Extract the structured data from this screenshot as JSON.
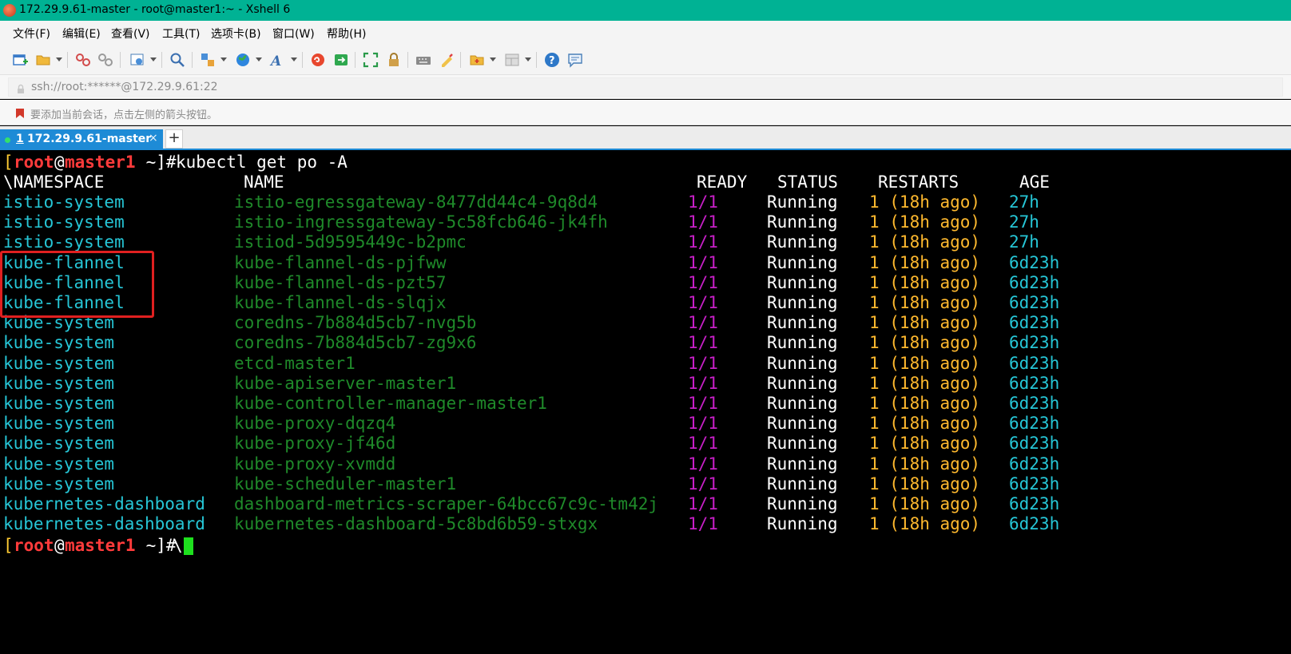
{
  "window": {
    "title": "172.29.9.61-master - root@master1:~ - Xshell 6"
  },
  "menu": [
    "文件(F)",
    "编辑(E)",
    "查看(V)",
    "工具(T)",
    "选项卡(B)",
    "窗口(W)",
    "帮助(H)"
  ],
  "address": {
    "value": "ssh://root:******@172.29.9.61:22"
  },
  "hint": {
    "text": "要添加当前会话，点击左侧的箭头按钮。"
  },
  "tabs": [
    {
      "number": "1",
      "label": "172.29.9.61-master",
      "close": "×"
    }
  ],
  "tab_add": "+",
  "terminal": {
    "prompt": {
      "open": "[",
      "user": "root",
      "at": "@",
      "host": "master1",
      "rest": " ~]#"
    },
    "command": "kubectl get po -A",
    "headers": {
      "namespace": "\\NAMESPACE",
      "name": "NAME",
      "ready": "READY",
      "status": "STATUS",
      "restarts": "RESTARTS",
      "age": "AGE"
    },
    "rows": [
      {
        "ns": "istio-system",
        "name": "istio-egressgateway-8477dd44c4-9q8d4",
        "ready": "1/1",
        "status": "Running",
        "restarts": "1 (18h ago)",
        "age": "27h"
      },
      {
        "ns": "istio-system",
        "name": "istio-ingressgateway-5c58fcb646-jk4fh",
        "ready": "1/1",
        "status": "Running",
        "restarts": "1 (18h ago)",
        "age": "27h"
      },
      {
        "ns": "istio-system",
        "name": "istiod-5d9595449c-b2pmc",
        "ready": "1/1",
        "status": "Running",
        "restarts": "1 (18h ago)",
        "age": "27h"
      },
      {
        "ns": "kube-flannel",
        "name": "kube-flannel-ds-pjfww",
        "ready": "1/1",
        "status": "Running",
        "restarts": "1 (18h ago)",
        "age": "6d23h"
      },
      {
        "ns": "kube-flannel",
        "name": "kube-flannel-ds-pzt57",
        "ready": "1/1",
        "status": "Running",
        "restarts": "1 (18h ago)",
        "age": "6d23h"
      },
      {
        "ns": "kube-flannel",
        "name": "kube-flannel-ds-slqjx",
        "ready": "1/1",
        "status": "Running",
        "restarts": "1 (18h ago)",
        "age": "6d23h"
      },
      {
        "ns": "kube-system",
        "name": "coredns-7b884d5cb7-nvg5b",
        "ready": "1/1",
        "status": "Running",
        "restarts": "1 (18h ago)",
        "age": "6d23h"
      },
      {
        "ns": "kube-system",
        "name": "coredns-7b884d5cb7-zg9x6",
        "ready": "1/1",
        "status": "Running",
        "restarts": "1 (18h ago)",
        "age": "6d23h"
      },
      {
        "ns": "kube-system",
        "name": "etcd-master1",
        "ready": "1/1",
        "status": "Running",
        "restarts": "1 (18h ago)",
        "age": "6d23h"
      },
      {
        "ns": "kube-system",
        "name": "kube-apiserver-master1",
        "ready": "1/1",
        "status": "Running",
        "restarts": "1 (18h ago)",
        "age": "6d23h"
      },
      {
        "ns": "kube-system",
        "name": "kube-controller-manager-master1",
        "ready": "1/1",
        "status": "Running",
        "restarts": "1 (18h ago)",
        "age": "6d23h"
      },
      {
        "ns": "kube-system",
        "name": "kube-proxy-dqzq4",
        "ready": "1/1",
        "status": "Running",
        "restarts": "1 (18h ago)",
        "age": "6d23h"
      },
      {
        "ns": "kube-system",
        "name": "kube-proxy-jf46d",
        "ready": "1/1",
        "status": "Running",
        "restarts": "1 (18h ago)",
        "age": "6d23h"
      },
      {
        "ns": "kube-system",
        "name": "kube-proxy-xvmdd",
        "ready": "1/1",
        "status": "Running",
        "restarts": "1 (18h ago)",
        "age": "6d23h"
      },
      {
        "ns": "kube-system",
        "name": "kube-scheduler-master1",
        "ready": "1/1",
        "status": "Running",
        "restarts": "1 (18h ago)",
        "age": "6d23h"
      },
      {
        "ns": "kubernetes-dashboard",
        "name": "dashboard-metrics-scraper-64bcc67c9c-tm42j",
        "ready": "1/1",
        "status": "Running",
        "restarts": "1 (18h ago)",
        "age": "6d23h"
      },
      {
        "ns": "kubernetes-dashboard",
        "name": "kubernetes-dashboard-5c8bd6b59-stxgx",
        "ready": "1/1",
        "status": "Running",
        "restarts": "1 (18h ago)",
        "age": "6d23h"
      }
    ],
    "final_prompt_suffix": "\\",
    "colors": {
      "namespace": "#26c6d6",
      "name": "#1f8a2a",
      "ready": "#c71fc7",
      "restarts": "#ffb92e",
      "highlight": "#e02020"
    }
  },
  "toolbar_icons": [
    "new-session-icon",
    "open-folder-icon",
    "connect-icon",
    "disconnect-icon",
    "properties-icon",
    "find-icon",
    "transfer-icon",
    "globe-icon",
    "font-icon",
    "xshell-icon",
    "xftp-icon",
    "fullscreen-icon",
    "lock-icon",
    "keyboard-icon",
    "highlight-icon",
    "new-folder-icon",
    "layout-icon",
    "help-icon",
    "chat-icon"
  ]
}
